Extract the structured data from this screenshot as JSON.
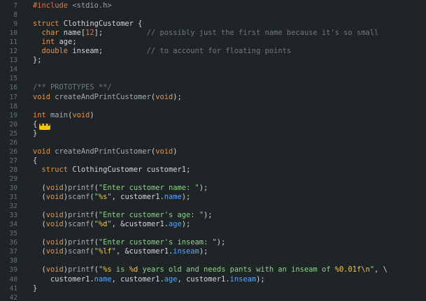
{
  "editor": {
    "fold_marker": "•••",
    "lines": [
      {
        "n": "7",
        "tokens": [
          {
            "t": "#include ",
            "c": "pre"
          },
          {
            "t": "<stdio.h>",
            "c": "inc"
          }
        ]
      },
      {
        "n": "8",
        "tokens": []
      },
      {
        "n": "9",
        "tokens": [
          {
            "t": "struct ",
            "c": "kw"
          },
          {
            "t": "ClothingCustomer {",
            "c": "plain"
          }
        ]
      },
      {
        "n": "10",
        "tokens": [
          {
            "t": "  ",
            "c": "plain"
          },
          {
            "t": "char ",
            "c": "kw"
          },
          {
            "t": "name[",
            "c": "plain"
          },
          {
            "t": "12",
            "c": "num"
          },
          {
            "t": "];          ",
            "c": "plain"
          },
          {
            "t": "// possibly just the first name because it's so small",
            "c": "cmt"
          }
        ]
      },
      {
        "n": "11",
        "tokens": [
          {
            "t": "  ",
            "c": "plain"
          },
          {
            "t": "int ",
            "c": "kw"
          },
          {
            "t": "age;",
            "c": "plain"
          }
        ]
      },
      {
        "n": "12",
        "tokens": [
          {
            "t": "  ",
            "c": "plain"
          },
          {
            "t": "double ",
            "c": "kw"
          },
          {
            "t": "inseam;          ",
            "c": "plain"
          },
          {
            "t": "// to account for floating points",
            "c": "cmt"
          }
        ]
      },
      {
        "n": "13",
        "tokens": [
          {
            "t": "};",
            "c": "plain"
          }
        ]
      },
      {
        "n": "14",
        "tokens": []
      },
      {
        "n": "15",
        "tokens": []
      },
      {
        "n": "16",
        "tokens": [
          {
            "t": "/** PROTOTYPES **/",
            "c": "cmt"
          }
        ]
      },
      {
        "n": "17",
        "tokens": [
          {
            "t": "void ",
            "c": "kw"
          },
          {
            "t": "createAndPrintCustomer",
            "c": "fn"
          },
          {
            "t": "(",
            "c": "plain"
          },
          {
            "t": "void",
            "c": "kw"
          },
          {
            "t": ");",
            "c": "plain"
          }
        ]
      },
      {
        "n": "18",
        "tokens": []
      },
      {
        "n": "19",
        "tokens": [
          {
            "t": "int ",
            "c": "kw"
          },
          {
            "t": "main",
            "c": "fn"
          },
          {
            "t": "(",
            "c": "plain"
          },
          {
            "t": "void",
            "c": "kw"
          },
          {
            "t": ")",
            "c": "plain"
          }
        ]
      },
      {
        "n": "20",
        "fold": true,
        "tokens": [
          {
            "t": "{",
            "c": "plain"
          }
        ]
      },
      {
        "n": "25",
        "tokens": [
          {
            "t": "}",
            "c": "plain"
          }
        ]
      },
      {
        "n": "26",
        "tokens": []
      },
      {
        "n": "26",
        "tokens": [
          {
            "t": "void ",
            "c": "kw"
          },
          {
            "t": "createAndPrintCustomer",
            "c": "fn"
          },
          {
            "t": "(",
            "c": "plain"
          },
          {
            "t": "void",
            "c": "kw"
          },
          {
            "t": ")",
            "c": "plain"
          }
        ]
      },
      {
        "n": "27",
        "tokens": [
          {
            "t": "{",
            "c": "plain"
          }
        ]
      },
      {
        "n": "28",
        "tokens": [
          {
            "t": "  ",
            "c": "plain"
          },
          {
            "t": "struct ",
            "c": "kw"
          },
          {
            "t": "ClothingCustomer customer1;",
            "c": "plain"
          }
        ]
      },
      {
        "n": "29",
        "tokens": []
      },
      {
        "n": "30",
        "tokens": [
          {
            "t": "  (",
            "c": "plain"
          },
          {
            "t": "void",
            "c": "kw"
          },
          {
            "t": ")",
            "c": "plain"
          },
          {
            "t": "printf",
            "c": "fn"
          },
          {
            "t": "(",
            "c": "plain"
          },
          {
            "t": "\"Enter customer name: \"",
            "c": "str"
          },
          {
            "t": ");",
            "c": "plain"
          }
        ]
      },
      {
        "n": "31",
        "tokens": [
          {
            "t": "  (",
            "c": "plain"
          },
          {
            "t": "void",
            "c": "kw"
          },
          {
            "t": ")",
            "c": "plain"
          },
          {
            "t": "scanf",
            "c": "fn"
          },
          {
            "t": "(",
            "c": "plain"
          },
          {
            "t": "\"",
            "c": "str"
          },
          {
            "t": "%s",
            "c": "fmt"
          },
          {
            "t": "\"",
            "c": "str"
          },
          {
            "t": ", customer1.",
            "c": "plain"
          },
          {
            "t": "name",
            "c": "prop"
          },
          {
            "t": ");",
            "c": "plain"
          }
        ]
      },
      {
        "n": "32",
        "tokens": []
      },
      {
        "n": "33",
        "tokens": [
          {
            "t": "  (",
            "c": "plain"
          },
          {
            "t": "void",
            "c": "kw"
          },
          {
            "t": ")",
            "c": "plain"
          },
          {
            "t": "printf",
            "c": "fn"
          },
          {
            "t": "(",
            "c": "plain"
          },
          {
            "t": "\"Enter customer's age: \"",
            "c": "str"
          },
          {
            "t": ");",
            "c": "plain"
          }
        ]
      },
      {
        "n": "34",
        "tokens": [
          {
            "t": "  (",
            "c": "plain"
          },
          {
            "t": "void",
            "c": "kw"
          },
          {
            "t": ")",
            "c": "plain"
          },
          {
            "t": "scanf",
            "c": "fn"
          },
          {
            "t": "(",
            "c": "plain"
          },
          {
            "t": "\"",
            "c": "str"
          },
          {
            "t": "%d",
            "c": "fmt"
          },
          {
            "t": "\"",
            "c": "str"
          },
          {
            "t": ", &customer1.",
            "c": "plain"
          },
          {
            "t": "age",
            "c": "prop"
          },
          {
            "t": ");",
            "c": "plain"
          }
        ]
      },
      {
        "n": "35",
        "tokens": []
      },
      {
        "n": "36",
        "tokens": [
          {
            "t": "  (",
            "c": "plain"
          },
          {
            "t": "void",
            "c": "kw"
          },
          {
            "t": ")",
            "c": "plain"
          },
          {
            "t": "printf",
            "c": "fn"
          },
          {
            "t": "(",
            "c": "plain"
          },
          {
            "t": "\"Enter customer's inseam: \"",
            "c": "str"
          },
          {
            "t": ");",
            "c": "plain"
          }
        ]
      },
      {
        "n": "37",
        "tokens": [
          {
            "t": "  (",
            "c": "plain"
          },
          {
            "t": "void",
            "c": "kw"
          },
          {
            "t": ")",
            "c": "plain"
          },
          {
            "t": "scanf",
            "c": "fn"
          },
          {
            "t": "(",
            "c": "plain"
          },
          {
            "t": "\"",
            "c": "str"
          },
          {
            "t": "%lf",
            "c": "fmt"
          },
          {
            "t": "\"",
            "c": "str"
          },
          {
            "t": ", &customer1.",
            "c": "plain"
          },
          {
            "t": "inseam",
            "c": "prop"
          },
          {
            "t": ");",
            "c": "plain"
          }
        ]
      },
      {
        "n": "38",
        "tokens": []
      },
      {
        "n": "39",
        "tokens": [
          {
            "t": "  (",
            "c": "plain"
          },
          {
            "t": "void",
            "c": "kw"
          },
          {
            "t": ")",
            "c": "plain"
          },
          {
            "t": "printf",
            "c": "fn"
          },
          {
            "t": "(",
            "c": "plain"
          },
          {
            "t": "\"",
            "c": "str"
          },
          {
            "t": "%s",
            "c": "fmt"
          },
          {
            "t": " is ",
            "c": "str"
          },
          {
            "t": "%d",
            "c": "fmt"
          },
          {
            "t": " years old and needs pants with an inseam of ",
            "c": "str"
          },
          {
            "t": "%0.01f\\n",
            "c": "fmt"
          },
          {
            "t": "\"",
            "c": "str"
          },
          {
            "t": ", \\",
            "c": "plain"
          }
        ]
      },
      {
        "n": "40",
        "tokens": [
          {
            "t": "    customer1.",
            "c": "plain"
          },
          {
            "t": "name",
            "c": "prop"
          },
          {
            "t": ", customer1.",
            "c": "plain"
          },
          {
            "t": "age",
            "c": "prop"
          },
          {
            "t": ", customer1.",
            "c": "plain"
          },
          {
            "t": "inseam",
            "c": "prop"
          },
          {
            "t": ");",
            "c": "plain"
          }
        ]
      },
      {
        "n": "41",
        "tokens": [
          {
            "t": "}",
            "c": "plain"
          }
        ]
      },
      {
        "n": "42",
        "tokens": []
      }
    ]
  }
}
